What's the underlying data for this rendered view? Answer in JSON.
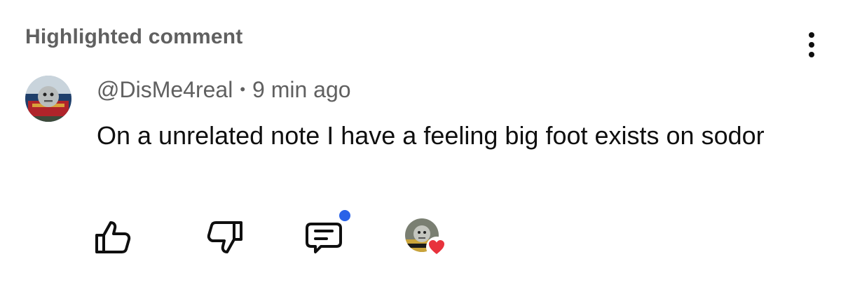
{
  "header": {
    "label": "Highlighted comment"
  },
  "menu": {
    "icon": "more-vert-icon"
  },
  "comment": {
    "author": "@DisMe4real",
    "separator": "•",
    "time": "9 min ago",
    "text": "On a unrelated note I have a feeling big foot exists on sodor"
  },
  "actions": {
    "like_icon": "thumb-up-icon",
    "dislike_icon": "thumb-down-icon",
    "reply_icon": "comment-icon",
    "reply_badge_color": "#2962e8",
    "heart_color": "#e8323c"
  }
}
